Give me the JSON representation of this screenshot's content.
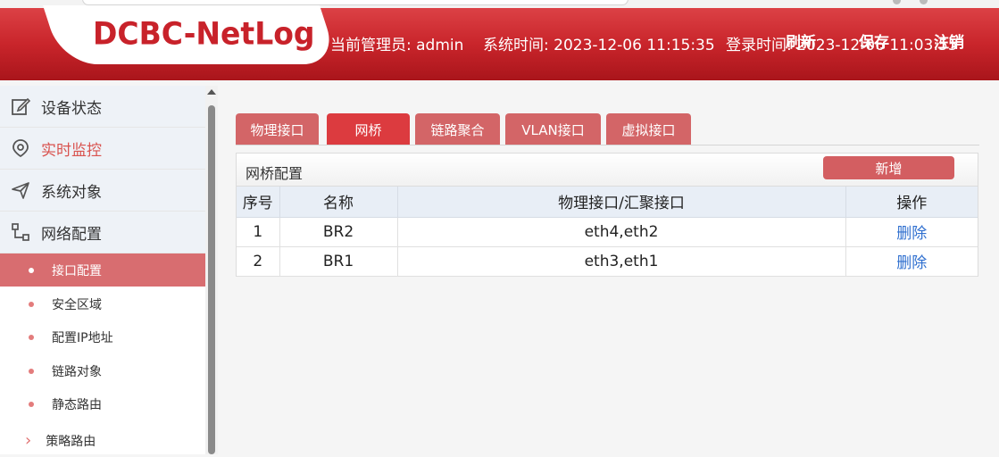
{
  "header": {
    "logo": "DCBC-NetLog",
    "admin_label": "当前管理员: admin",
    "time_label": "系统时间: 2023-12-06 11:15:35",
    "login_label": "登录时间: 2023-12-06 11:03:55",
    "refresh_label": "刷新",
    "save_label": "保存",
    "logout_label": "注销"
  },
  "sidebar": {
    "items": [
      {
        "label": "设备状态",
        "icon": "edit-icon"
      },
      {
        "label": "实时监控",
        "icon": "location-icon"
      },
      {
        "label": "系统对象",
        "icon": "send-icon"
      },
      {
        "label": "网络配置",
        "icon": "network-icon"
      }
    ],
    "subitems": [
      {
        "label": "接口配置"
      },
      {
        "label": "安全区域"
      },
      {
        "label": "配置IP地址"
      },
      {
        "label": "链路对象"
      },
      {
        "label": "静态路由"
      },
      {
        "label": "策略路由"
      }
    ]
  },
  "tabs": [
    "物理接口",
    "网桥",
    "链路聚合",
    "VLAN接口",
    "虚拟接口"
  ],
  "panel": {
    "title": "网桥配置",
    "add_label": "新增",
    "columns": [
      "序号",
      "名称",
      "物理接口/汇聚接口",
      "操作"
    ],
    "rows": [
      {
        "index": "1",
        "name": "BR2",
        "interfaces": "eth4,eth2",
        "action": "删除"
      },
      {
        "index": "2",
        "name": "BR1",
        "interfaces": "eth3,eth1",
        "action": "删除"
      }
    ]
  },
  "colors": {
    "brand_red": "#c9252b",
    "tab": "#d36567",
    "tab_active": "#dc3b3f",
    "link": "#2f6fcf"
  }
}
